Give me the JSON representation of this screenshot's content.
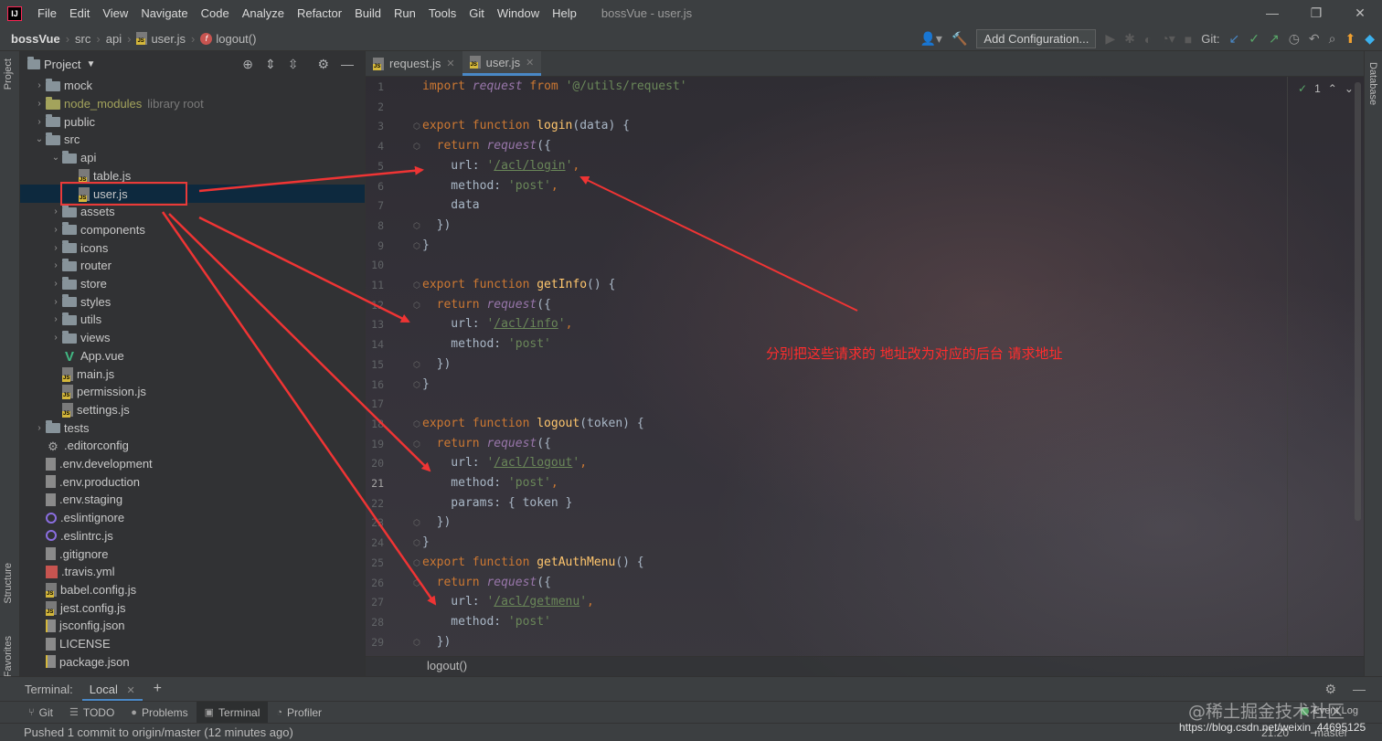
{
  "menubar": {
    "app_icon": "IJ",
    "items": [
      "File",
      "Edit",
      "View",
      "Navigate",
      "Code",
      "Analyze",
      "Refactor",
      "Build",
      "Run",
      "Tools",
      "Git",
      "Window",
      "Help"
    ],
    "title": "bossVue - user.js",
    "win_controls": [
      "—",
      "❐",
      "✕"
    ]
  },
  "navbar": {
    "crumbs": [
      "bossVue",
      "src",
      "api",
      "user.js",
      "logout()"
    ],
    "fn_badge": "f",
    "add_configuration": "Add Configuration...",
    "git_label": "Git:"
  },
  "left_strip": {
    "project": "Project",
    "structure": "Structure",
    "favorites": "Favorites"
  },
  "right_strip": {
    "database": "Database"
  },
  "project_panel": {
    "title": "Project",
    "tree": [
      {
        "label": "mock",
        "type": "folder",
        "level": 1,
        "expand": "›"
      },
      {
        "label": "node_modules",
        "type": "folder-nm",
        "level": 1,
        "expand": "›",
        "suffix": "library root"
      },
      {
        "label": "public",
        "type": "folder",
        "level": 1,
        "expand": "›"
      },
      {
        "label": "src",
        "type": "folder",
        "level": 1,
        "expand": "⌄"
      },
      {
        "label": "api",
        "type": "folder",
        "level": 2,
        "expand": "⌄"
      },
      {
        "label": "table.js",
        "type": "js",
        "level": 3,
        "expand": ""
      },
      {
        "label": "user.js",
        "type": "js",
        "level": 3,
        "expand": "",
        "selected": true
      },
      {
        "label": "assets",
        "type": "folder",
        "level": 2,
        "expand": "›"
      },
      {
        "label": "components",
        "type": "folder",
        "level": 2,
        "expand": "›"
      },
      {
        "label": "icons",
        "type": "folder",
        "level": 2,
        "expand": "›"
      },
      {
        "label": "router",
        "type": "folder",
        "level": 2,
        "expand": "›"
      },
      {
        "label": "store",
        "type": "folder",
        "level": 2,
        "expand": "›"
      },
      {
        "label": "styles",
        "type": "folder",
        "level": 2,
        "expand": "›"
      },
      {
        "label": "utils",
        "type": "folder",
        "level": 2,
        "expand": "›"
      },
      {
        "label": "views",
        "type": "folder",
        "level": 2,
        "expand": "›"
      },
      {
        "label": "App.vue",
        "type": "vue",
        "level": 2,
        "expand": ""
      },
      {
        "label": "main.js",
        "type": "js",
        "level": 2,
        "expand": ""
      },
      {
        "label": "permission.js",
        "type": "js",
        "level": 2,
        "expand": ""
      },
      {
        "label": "settings.js",
        "type": "js",
        "level": 2,
        "expand": ""
      },
      {
        "label": "tests",
        "type": "folder",
        "level": 1,
        "expand": "›"
      },
      {
        "label": ".editorconfig",
        "type": "gear",
        "level": 1,
        "expand": ""
      },
      {
        "label": ".env.development",
        "type": "file",
        "level": 1,
        "expand": ""
      },
      {
        "label": ".env.production",
        "type": "file",
        "level": 1,
        "expand": ""
      },
      {
        "label": ".env.staging",
        "type": "file",
        "level": 1,
        "expand": ""
      },
      {
        "label": ".eslintignore",
        "type": "ring",
        "level": 1,
        "expand": ""
      },
      {
        "label": ".eslintrc.js",
        "type": "ring",
        "level": 1,
        "expand": ""
      },
      {
        "label": ".gitignore",
        "type": "file",
        "level": 1,
        "expand": ""
      },
      {
        "label": ".travis.yml",
        "type": "yml",
        "level": 1,
        "expand": ""
      },
      {
        "label": "babel.config.js",
        "type": "js",
        "level": 1,
        "expand": ""
      },
      {
        "label": "jest.config.js",
        "type": "js",
        "level": 1,
        "expand": ""
      },
      {
        "label": "jsconfig.json",
        "type": "json",
        "level": 1,
        "expand": ""
      },
      {
        "label": "LICENSE",
        "type": "file",
        "level": 1,
        "expand": ""
      },
      {
        "label": "package.json",
        "type": "json",
        "level": 1,
        "expand": ""
      }
    ]
  },
  "editor": {
    "tabs": [
      {
        "label": "request.js",
        "active": false
      },
      {
        "label": "user.js",
        "active": true
      }
    ],
    "current_line": 21,
    "analysis_count": "1",
    "breadcrumb": "logout()",
    "lines": [
      [
        {
          "t": "import ",
          "c": "kw"
        },
        {
          "t": "request ",
          "c": "it"
        },
        {
          "t": "from ",
          "c": "kw"
        },
        {
          "t": "'@/utils/request'",
          "c": "str"
        }
      ],
      [],
      [
        {
          "t": "export function ",
          "c": "kw"
        },
        {
          "t": "login",
          "c": "fn"
        },
        {
          "t": "(data) {",
          "c": ""
        }
      ],
      [
        {
          "t": "  return ",
          "c": "kw"
        },
        {
          "t": "request",
          "c": "it"
        },
        {
          "t": "({",
          "c": ""
        }
      ],
      [
        {
          "t": "    url: ",
          "c": ""
        },
        {
          "t": "'",
          "c": "str"
        },
        {
          "t": "/acl/login",
          "c": "url"
        },
        {
          "t": "'",
          "c": "str"
        },
        {
          "t": ",",
          "c": "kw"
        }
      ],
      [
        {
          "t": "    method: ",
          "c": ""
        },
        {
          "t": "'post'",
          "c": "str"
        },
        {
          "t": ",",
          "c": "kw"
        }
      ],
      [
        {
          "t": "    data",
          "c": ""
        }
      ],
      [
        {
          "t": "  })",
          "c": ""
        }
      ],
      [
        {
          "t": "}",
          "c": ""
        }
      ],
      [],
      [
        {
          "t": "export function ",
          "c": "kw"
        },
        {
          "t": "getInfo",
          "c": "fn"
        },
        {
          "t": "() {",
          "c": ""
        }
      ],
      [
        {
          "t": "  return ",
          "c": "kw"
        },
        {
          "t": "request",
          "c": "it"
        },
        {
          "t": "({",
          "c": ""
        }
      ],
      [
        {
          "t": "    url: ",
          "c": ""
        },
        {
          "t": "'",
          "c": "str"
        },
        {
          "t": "/acl/info",
          "c": "url"
        },
        {
          "t": "'",
          "c": "str"
        },
        {
          "t": ",",
          "c": "kw"
        }
      ],
      [
        {
          "t": "    method: ",
          "c": ""
        },
        {
          "t": "'post'",
          "c": "str"
        }
      ],
      [
        {
          "t": "  })",
          "c": ""
        }
      ],
      [
        {
          "t": "}",
          "c": ""
        }
      ],
      [],
      [
        {
          "t": "export function ",
          "c": "kw"
        },
        {
          "t": "logout",
          "c": "fn"
        },
        {
          "t": "(token) {",
          "c": ""
        }
      ],
      [
        {
          "t": "  return ",
          "c": "kw"
        },
        {
          "t": "request",
          "c": "it"
        },
        {
          "t": "({",
          "c": ""
        }
      ],
      [
        {
          "t": "    url: ",
          "c": ""
        },
        {
          "t": "'",
          "c": "str"
        },
        {
          "t": "/acl/logout",
          "c": "url"
        },
        {
          "t": "'",
          "c": "str"
        },
        {
          "t": ",",
          "c": "kw"
        }
      ],
      [
        {
          "t": "    method: ",
          "c": ""
        },
        {
          "t": "'post'",
          "c": "str"
        },
        {
          "t": ",",
          "c": "kw"
        }
      ],
      [
        {
          "t": "    params: { token }",
          "c": ""
        }
      ],
      [
        {
          "t": "  })",
          "c": ""
        }
      ],
      [
        {
          "t": "}",
          "c": ""
        }
      ],
      [
        {
          "t": "export function ",
          "c": "kw"
        },
        {
          "t": "getAuthMenu",
          "c": "fn"
        },
        {
          "t": "() {",
          "c": ""
        }
      ],
      [
        {
          "t": "  return ",
          "c": "kw"
        },
        {
          "t": "request",
          "c": "it"
        },
        {
          "t": "({",
          "c": ""
        }
      ],
      [
        {
          "t": "    url: ",
          "c": ""
        },
        {
          "t": "'",
          "c": "str"
        },
        {
          "t": "/acl/getmenu",
          "c": "url"
        },
        {
          "t": "'",
          "c": "str"
        },
        {
          "t": ",",
          "c": "kw"
        }
      ],
      [
        {
          "t": "    method: ",
          "c": ""
        },
        {
          "t": "'post'",
          "c": "str"
        }
      ],
      [
        {
          "t": "  })",
          "c": ""
        }
      ]
    ]
  },
  "annotation": {
    "text": "分别把这些请求的 地址改为对应的后台 请求地址",
    "color": "#ff2d2d"
  },
  "terminal": {
    "label": "Terminal:",
    "tab": "Local"
  },
  "tool_windows": [
    {
      "label": "Git",
      "sym": "⑂",
      "active": false
    },
    {
      "label": "TODO",
      "sym": "☰",
      "active": false
    },
    {
      "label": "Problems",
      "sym": "●",
      "active": false
    },
    {
      "label": "Terminal",
      "sym": "▣",
      "active": true
    },
    {
      "label": "Profiler",
      "sym": "◔",
      "active": false
    }
  ],
  "event_log": "Event Log",
  "statusbar": {
    "message": "Pushed 1 commit to origin/master (12 minutes ago)",
    "position": "21:20",
    "branch": "master"
  },
  "watermark": {
    "brand": "@稀土掘金技术社区",
    "url": "https://blog.csdn.net/weixin_44695125"
  },
  "colors": {
    "keyword": "#cc7832",
    "function": "#ffc66d",
    "string": "#6a8759",
    "accent": "#4a88c7"
  }
}
